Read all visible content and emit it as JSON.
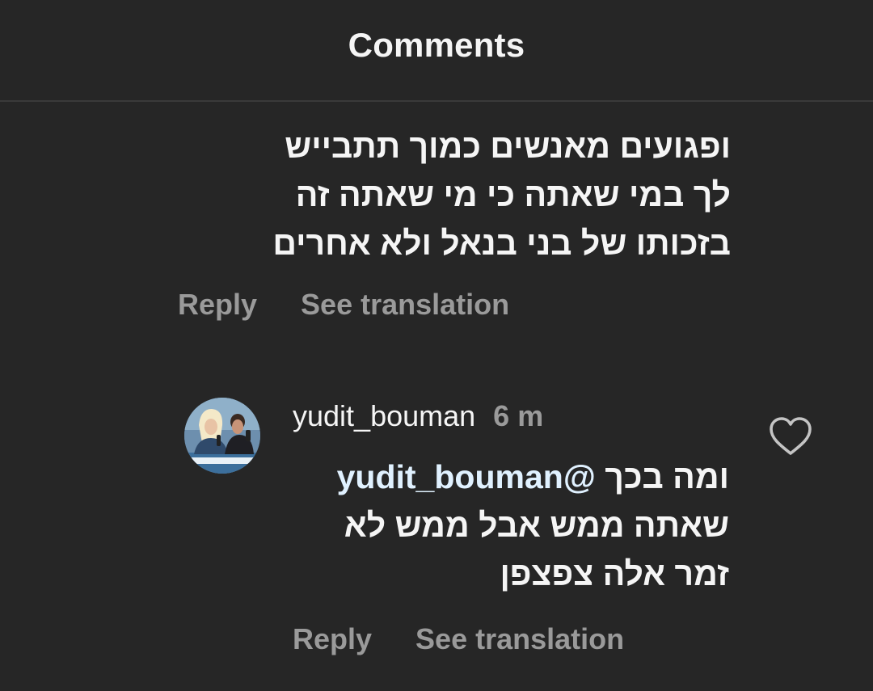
{
  "header": {
    "title": "Comments"
  },
  "comment1": {
    "lines": [
      "ופגועים מאנשים כמוך תתבייש",
      "לך במי שאתה כי מי שאתה זה",
      "בזכותו של בני בנאל ולא אחרים"
    ],
    "reply_label": "Reply",
    "see_translation_label": "See translation"
  },
  "comment2": {
    "username": "yudit_bouman",
    "time": "6 m",
    "mention": "@yudit_bouman",
    "line1_rest": "ומה בכך",
    "line2": "שאתה ממש אבל ממש לא",
    "line3": "זמר אלה צפצפן",
    "reply_label": "Reply",
    "see_translation_label": "See translation",
    "like_icon": "heart-outline-icon"
  },
  "colors": {
    "background": "#262626",
    "primary_text": "#f5f5f5",
    "secondary_text": "#9a9a9a",
    "mention": "#e0f1ff",
    "divider": "#3a3a3a"
  }
}
